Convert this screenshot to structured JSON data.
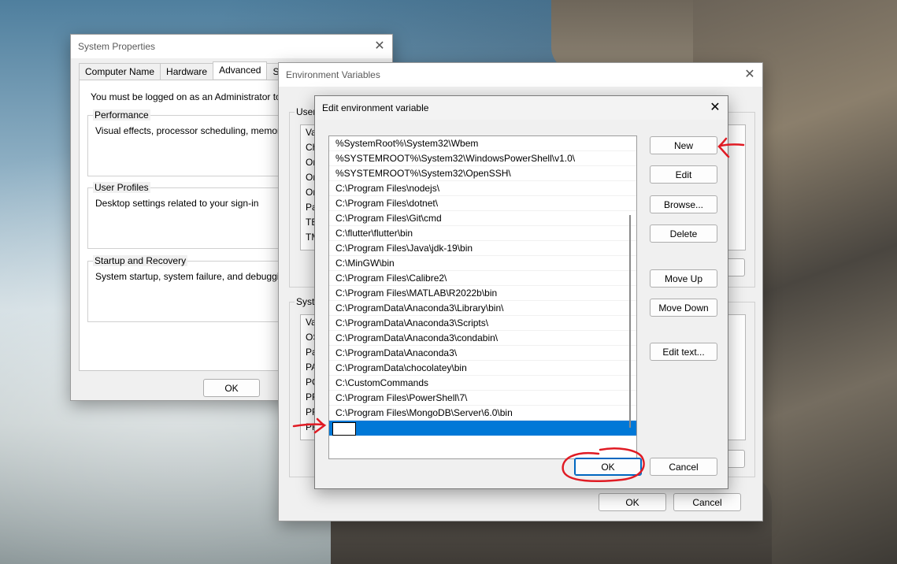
{
  "system_properties": {
    "title": "System Properties",
    "tabs": [
      "Computer Name",
      "Hardware",
      "Advanced",
      "System P"
    ],
    "selected_tab": "Advanced",
    "admin_notice": "You must be logged on as an Administrator to make",
    "performance": {
      "label": "Performance",
      "text": "Visual effects, processor scheduling, memory usag"
    },
    "user_profiles": {
      "label": "User Profiles",
      "text": "Desktop settings related to your sign-in"
    },
    "startup_recovery": {
      "label": "Startup and Recovery",
      "text": "System startup, system failure, and debugging info"
    },
    "ok_label": "OK"
  },
  "environment_variables": {
    "title": "Environment Variables",
    "user_group_label": "User",
    "user_list_header": "Va",
    "user_rows": [
      "Ch",
      "Or",
      "Or",
      "Or",
      "Pa",
      "TE",
      "TM"
    ],
    "system_group_label": "Syste",
    "system_list_header": "Va",
    "system_rows": [
      "OS",
      "Pa",
      "PA",
      "PC",
      "PR",
      "PR",
      "PR"
    ],
    "ok_label": "OK",
    "cancel_label": "Cancel"
  },
  "edit_env": {
    "title": "Edit environment variable",
    "paths": [
      "%SystemRoot%\\System32\\Wbem",
      "%SYSTEMROOT%\\System32\\WindowsPowerShell\\v1.0\\",
      "%SYSTEMROOT%\\System32\\OpenSSH\\",
      "C:\\Program Files\\nodejs\\",
      "C:\\Program Files\\dotnet\\",
      "C:\\Program Files\\Git\\cmd",
      "C:\\flutter\\flutter\\bin",
      "C:\\Program Files\\Java\\jdk-19\\bin",
      "C:\\MinGW\\bin",
      "C:\\Program Files\\Calibre2\\",
      "C:\\Program Files\\MATLAB\\R2022b\\bin",
      "C:\\ProgramData\\Anaconda3\\Library\\bin\\",
      "C:\\ProgramData\\Anaconda3\\Scripts\\",
      "C:\\ProgramData\\Anaconda3\\condabin\\",
      "C:\\ProgramData\\Anaconda3\\",
      "C:\\ProgramData\\chocolatey\\bin",
      "C:\\CustomCommands",
      "C:\\Program Files\\PowerShell\\7\\",
      "C:\\Program Files\\MongoDB\\Server\\6.0\\bin"
    ],
    "new_entry_value": "",
    "buttons": {
      "new": "New",
      "edit": "Edit",
      "browse": "Browse...",
      "delete": "Delete",
      "move_up": "Move Up",
      "move_down": "Move Down",
      "edit_text": "Edit text..."
    },
    "ok_label": "OK",
    "cancel_label": "Cancel"
  },
  "colors": {
    "selection": "#0078d7",
    "annotation": "#e01b24"
  }
}
